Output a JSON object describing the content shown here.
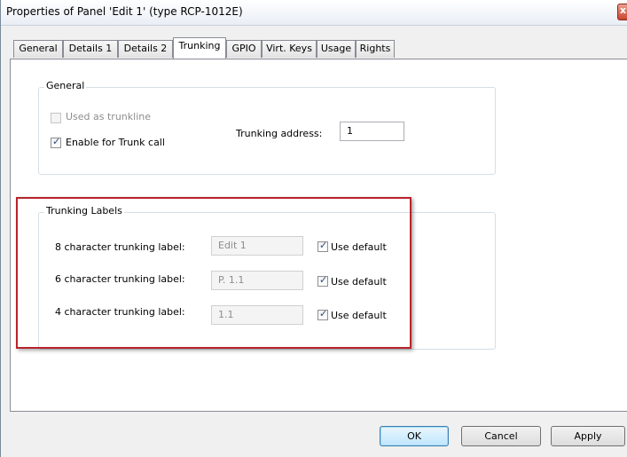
{
  "window": {
    "title": "Properties of Panel 'Edit 1' (type RCP-1012E)",
    "close_glyph": "x"
  },
  "tabs": [
    {
      "label": "General",
      "active": false
    },
    {
      "label": "Details 1",
      "active": false
    },
    {
      "label": "Details 2",
      "active": false
    },
    {
      "label": "Trunking",
      "active": true
    },
    {
      "label": "GPIO",
      "active": false
    },
    {
      "label": "Virt. Keys",
      "active": false
    },
    {
      "label": "Usage",
      "active": false
    },
    {
      "label": "Rights",
      "active": false
    }
  ],
  "general_group": {
    "legend": "General",
    "used_as_trunkline": {
      "label": "Used as trunkline",
      "checked": false,
      "enabled": false
    },
    "enable_trunk_call": {
      "label": "Enable for Trunk call",
      "checked": true,
      "enabled": true
    },
    "trunking_address": {
      "label": "Trunking address:",
      "value": "1"
    }
  },
  "labels_group": {
    "legend": "Trunking Labels",
    "rows": [
      {
        "label": "8 character trunking label:",
        "value": "Edit 1",
        "use_default": "Use default",
        "checked": true
      },
      {
        "label": "6 character trunking label:",
        "value": "P. 1.1",
        "use_default": "Use default",
        "checked": true
      },
      {
        "label": "4 character trunking label:",
        "value": "1.1",
        "use_default": "Use default",
        "checked": true
      }
    ]
  },
  "buttons": {
    "ok": "OK",
    "cancel": "Cancel",
    "apply": "Apply"
  },
  "colors": {
    "highlight_border": "#b8232b",
    "default_button": "#bee6fd",
    "checkmark": "#2b4a82"
  }
}
